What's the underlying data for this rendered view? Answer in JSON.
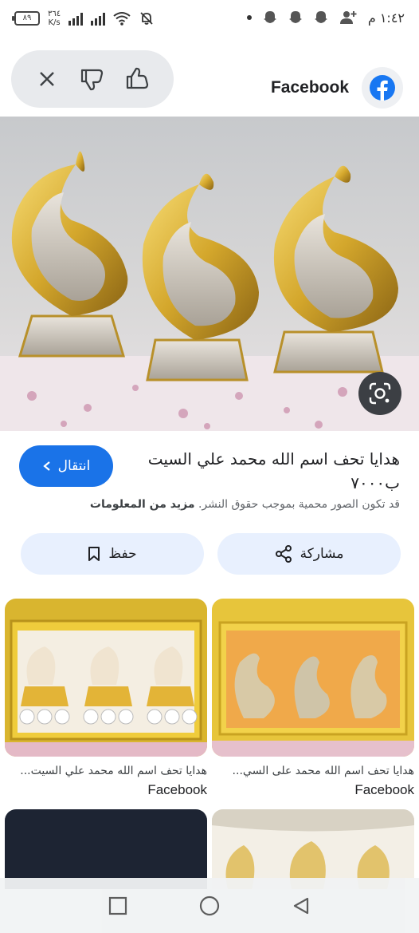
{
  "status_bar": {
    "battery": "٨٩",
    "net_speed_value": "٣٦٤",
    "net_speed_unit": "K/s",
    "time": "١:٤٢ م"
  },
  "toolbar": {
    "source_name": "Facebook"
  },
  "result": {
    "visit_label": "انتقال",
    "title": "هدايا تحف اسم الله محمد علي السيت ب٧٠٠٠",
    "copyright_text": "قد تكون الصور محمية بموجب حقوق النشر.",
    "more_info_link": "مزيد من المعلومات",
    "share_label": "مشاركة",
    "save_label": "حفظ"
  },
  "related": [
    {
      "caption": "هدايا تحف اسم الله محمد على السي...",
      "source": "Facebook"
    },
    {
      "caption": "هدايا تحف اسم الله محمد علي السيت...",
      "source": "Facebook"
    }
  ],
  "colors": {
    "accent": "#1a73e8",
    "chip_bg": "#e8f0fe",
    "facebook_blue": "#1877f2",
    "gold": "#d4a72c"
  },
  "icons": {
    "close": "close-icon",
    "dislike": "thumbs-down-icon",
    "like": "thumbs-up-icon",
    "facebook": "facebook-icon",
    "lens": "google-lens-icon",
    "share": "share-icon",
    "save": "bookmark-icon",
    "visit": "chevron-left-icon"
  }
}
